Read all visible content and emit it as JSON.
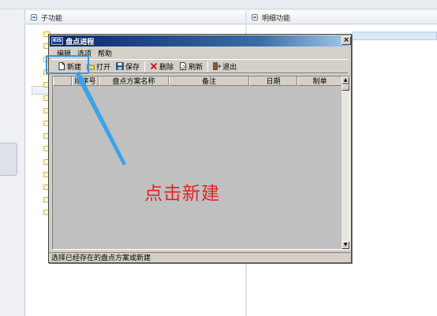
{
  "background": {
    "left_panel_title": "子功能",
    "right_panel_title": "明细功能",
    "left_folders": 15
  },
  "dialog": {
    "app_icon": "KIS",
    "title": "盘点进程",
    "close_label": "×",
    "menu": [
      {
        "label": "编辑"
      },
      {
        "label": "选项"
      },
      {
        "label": "帮助"
      }
    ],
    "toolbar": [
      {
        "label": "新建",
        "icon": "new-document-icon"
      },
      {
        "label": "打开",
        "icon": "open-icon"
      },
      {
        "label": "保存",
        "icon": "save-icon"
      },
      {
        "label": "删除",
        "icon": "delete-icon"
      },
      {
        "label": "刷新",
        "icon": "refresh-icon"
      },
      {
        "label": "退出",
        "icon": "exit-icon"
      }
    ],
    "columns": [
      "顺序号",
      "盘点方案名称",
      "备注",
      "日期",
      "制单"
    ],
    "status_text": "选择已经存在的盘点方案或新建"
  },
  "annotation": {
    "text": "点击新建",
    "color": "#e02424",
    "highlight_color": "#2f9ae0"
  }
}
